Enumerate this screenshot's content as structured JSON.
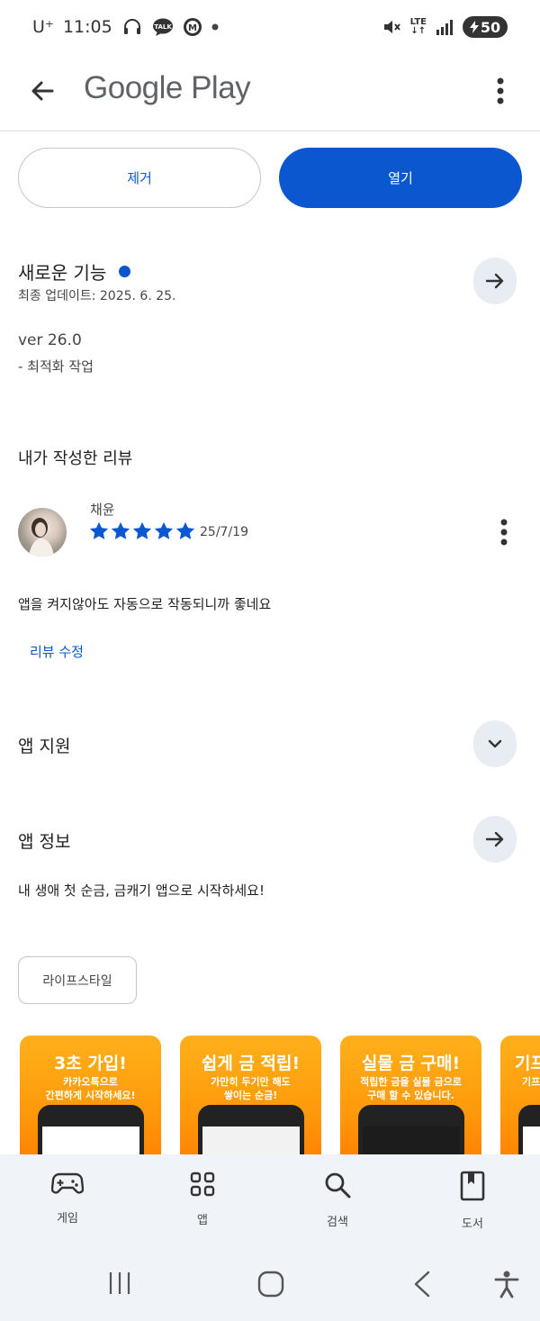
{
  "status_bar": {
    "carrier": "U⁺",
    "time": "11:05",
    "battery": "50",
    "network": "LTE"
  },
  "app_bar": {
    "title": "Google Play"
  },
  "actions": {
    "uninstall": "제거",
    "open": "열기"
  },
  "whats_new": {
    "title": "새로운 기능",
    "updated": "최종 업데이트: 2025. 6. 25.",
    "version": "ver 26.0",
    "note": "- 최적화 작업"
  },
  "review": {
    "section_title": "내가 작성한 리뷰",
    "reviewer": "채윤",
    "rating": 5,
    "date": "25/7/19",
    "text": "앱을 켜지않아도 자동으로 작동되니까 좋네요",
    "edit_label": "리뷰 수정"
  },
  "app_support": {
    "title": "앱 지원"
  },
  "about": {
    "title": "앱 정보",
    "description": "내 생애 첫 순금, 금캐기 앱으로 시작하세요!",
    "category": "라이프스타일"
  },
  "screenshots": [
    {
      "title": "3초 가입!",
      "line1": "카카오톡으로",
      "line2": "간편하게 시작하세요!"
    },
    {
      "title": "쉽게 금 적립!",
      "line1": "가만히 두기만 해도",
      "line2": "쌓이는 순금!"
    },
    {
      "title": "실물 금 구매!",
      "line1": "적립한 금을 실물 금으로",
      "line2": "구매 할 수 있습니다."
    },
    {
      "title": "기프",
      "line1": "기프",
      "line2": ""
    }
  ],
  "bottom_nav": [
    {
      "label": "게임",
      "icon": "gamepad-icon"
    },
    {
      "label": "앱",
      "icon": "apps-grid-icon"
    },
    {
      "label": "검색",
      "icon": "search-icon"
    },
    {
      "label": "도서",
      "icon": "book-icon"
    }
  ],
  "colors": {
    "accent": "#0b57d0",
    "nav_bg": "#f0f3f8",
    "round_btn_bg": "#e8ecf3"
  }
}
